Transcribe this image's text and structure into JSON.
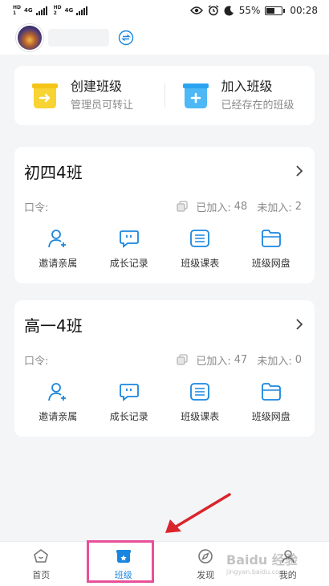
{
  "status_bar": {
    "sim1": [
      "HD",
      "1"
    ],
    "sim2": [
      "HD",
      "2"
    ],
    "net1": "4G",
    "net2": "4G",
    "battery_percent": "55%",
    "battery_level": 0.55,
    "time": "00:28",
    "icons": [
      "eye-icon",
      "alarm-icon",
      "moon-icon"
    ]
  },
  "top_bar": {
    "avatar_icon": "avatar",
    "switch_icon": "switch-icon"
  },
  "actions": [
    {
      "title": "创建班级",
      "subtitle": "管理员可转让",
      "icon": "create-class-icon",
      "color": "#f5c518"
    },
    {
      "title": "加入班级",
      "subtitle": "已经存在的班级",
      "icon": "join-class-icon",
      "color": "#2ba3f0"
    }
  ],
  "classes": [
    {
      "name": "初四4班",
      "password_label": "口令:",
      "joined_label": "已加入:",
      "joined_value": "48",
      "not_joined_label": "未加入:",
      "not_joined_value": "2"
    },
    {
      "name": "高一4班",
      "password_label": "口令:",
      "joined_label": "已加入:",
      "joined_value": "47",
      "not_joined_label": "未加入:",
      "not_joined_value": "0"
    }
  ],
  "tools": [
    {
      "label": "邀请亲属",
      "icon": "invite-icon"
    },
    {
      "label": "成长记录",
      "icon": "growth-record-icon"
    },
    {
      "label": "班级课表",
      "icon": "schedule-icon"
    },
    {
      "label": "班级网盘",
      "icon": "folder-icon"
    }
  ],
  "bottom_nav": [
    {
      "label": "首页",
      "icon": "home-icon",
      "active": false
    },
    {
      "label": "班级",
      "icon": "class-icon",
      "active": true
    },
    {
      "label": "发现",
      "icon": "compass-icon",
      "active": false
    },
    {
      "label": "我的",
      "icon": "profile-icon",
      "active": false
    }
  ],
  "watermark": {
    "text": "Baidu 经验",
    "sub": "jingyan.baidu.com"
  },
  "colors": {
    "accent": "#1a86e0",
    "highlight": "#e8509a",
    "arrow": "#d9252c",
    "background": "#f4f5f7"
  }
}
